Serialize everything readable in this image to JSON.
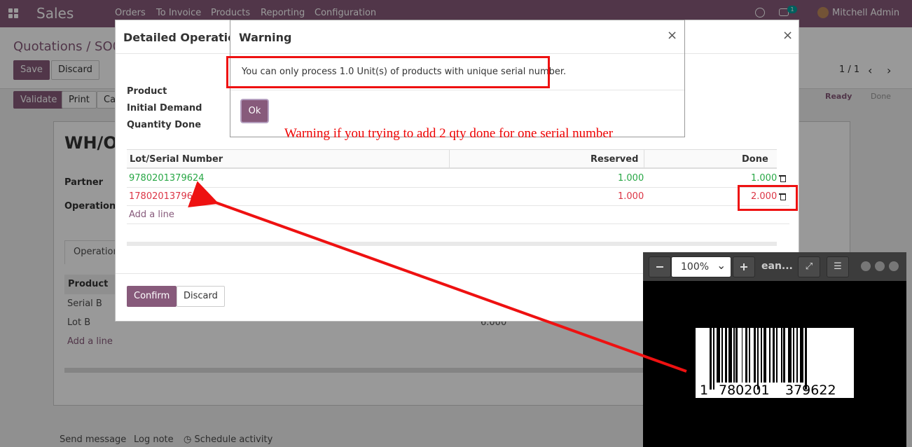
{
  "navbar": {
    "brand": "Sales",
    "menu": [
      "Orders",
      "To Invoice",
      "Products",
      "Reporting",
      "Configuration"
    ],
    "notifications": "1",
    "user": "Mitchell Admin"
  },
  "control_panel": {
    "breadcrumb": "Quotations / SO02",
    "save": "Save",
    "discard": "Discard",
    "pager": "1 / 1"
  },
  "picking_bar": {
    "validate": "Validate",
    "print": "Print",
    "cancel": "Ca",
    "stages": [
      "Ready",
      "Done"
    ]
  },
  "sheet": {
    "title": "WH/O",
    "partner_label": "Partner",
    "operation_label": "Operation T",
    "tab": "Operations",
    "col_product": "Product",
    "rows": [
      "Serial B",
      "Lot B"
    ],
    "lot_b_qty": "6.000",
    "add_line": "Add a line"
  },
  "chatter": {
    "send": "Send message",
    "log": "Log note",
    "schedule": "Schedule activity"
  },
  "detailed_ops": {
    "title": "Detailed Operations",
    "labels": [
      "Product",
      "Initial Demand",
      "Quantity Done"
    ],
    "columns": [
      "Lot/Serial Number",
      "Reserved",
      "Done"
    ],
    "lines": [
      {
        "lot": "9780201379624",
        "reserved": "1.000",
        "done": "1.000",
        "color": "#28a745"
      },
      {
        "lot": "1780201379622",
        "reserved": "1.000",
        "done": "2.000",
        "color": "#dc3545"
      }
    ],
    "add_line": "Add a line",
    "confirm": "Confirm",
    "discard": "Discard"
  },
  "warning": {
    "title": "Warning",
    "message": "You can only process 1.0 Unit(s) of products with unique serial number.",
    "ok": "Ok"
  },
  "annotation": "Warning if you trying to add 2 qty done for one serial number",
  "viewer": {
    "zoom": "100%",
    "filename": "ean...",
    "barcode_digits": [
      "1",
      "780201",
      "379622"
    ]
  },
  "colors": {
    "brand": "#875a7b",
    "annotation": "#e00"
  }
}
